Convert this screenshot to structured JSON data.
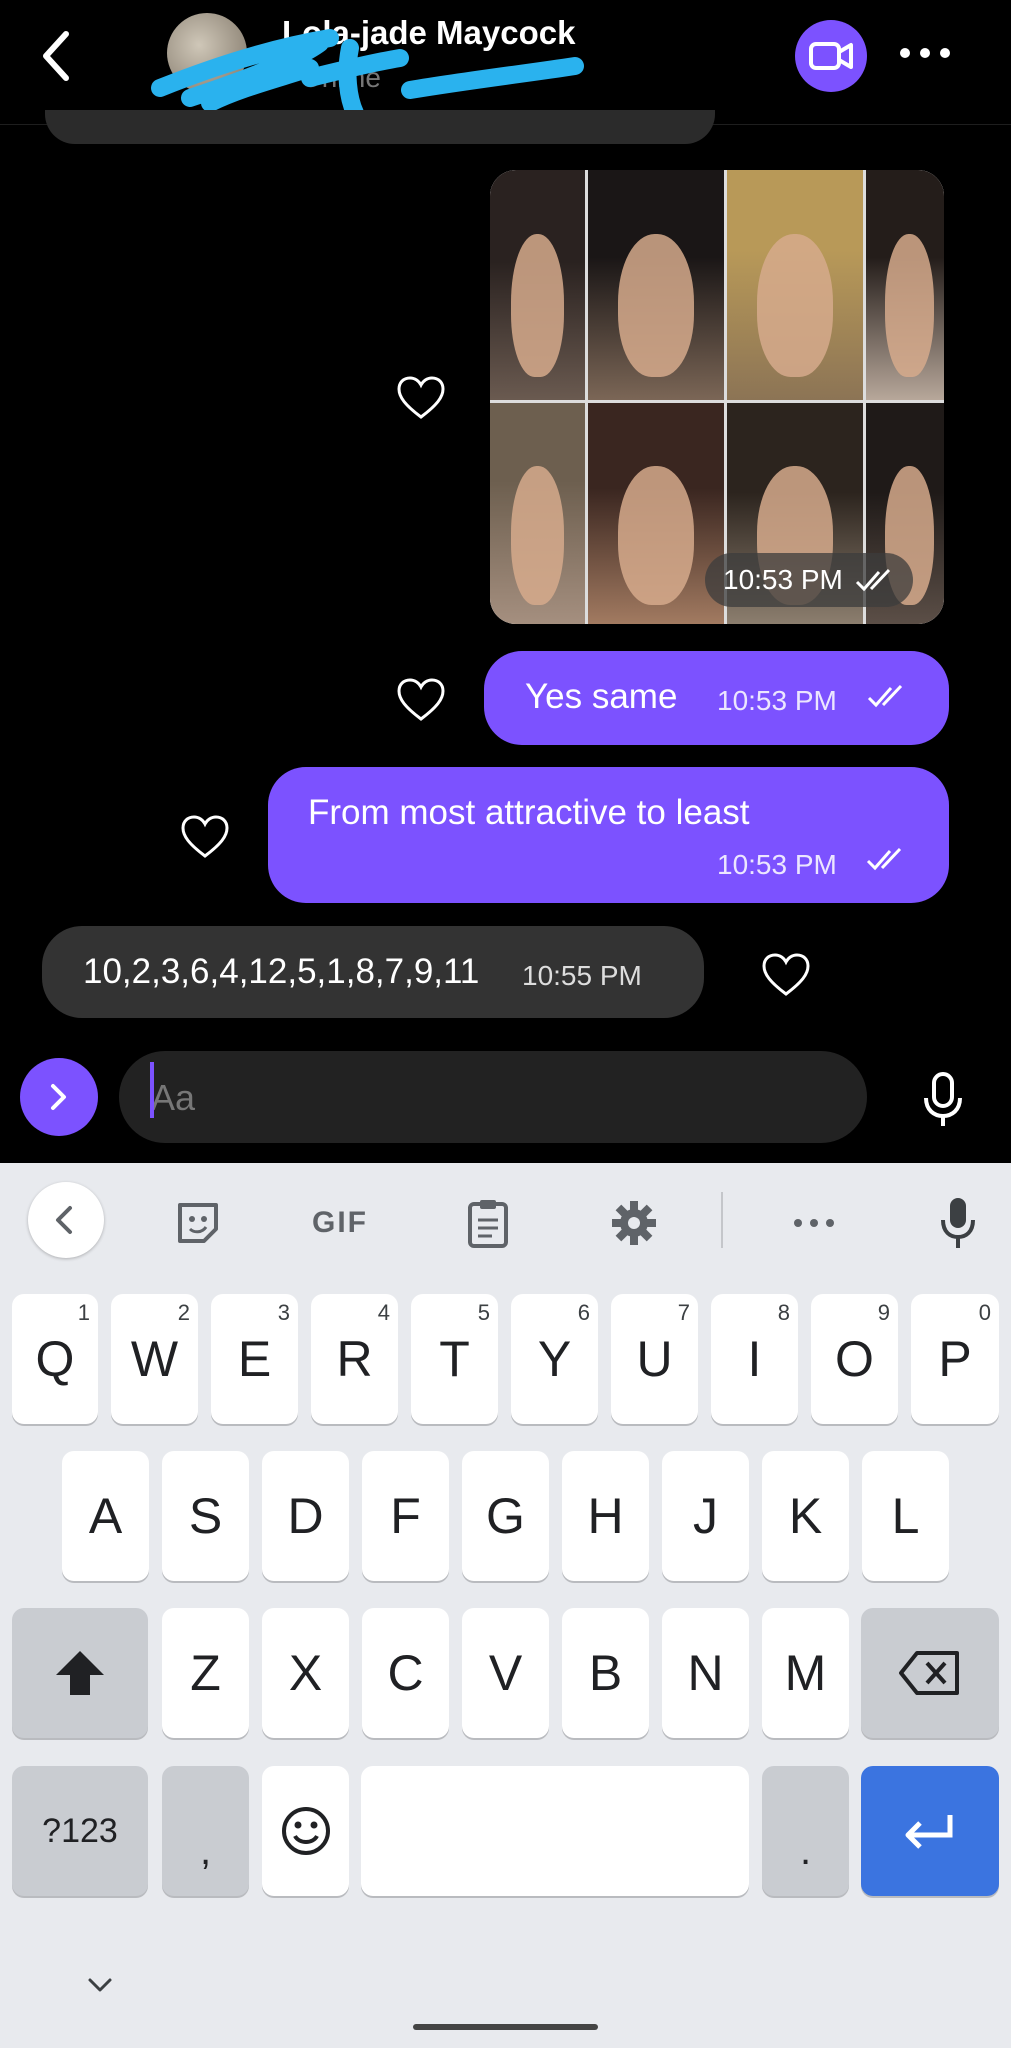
{
  "header": {
    "contact_name": "Lola-jade Maycock",
    "status": "Online",
    "video_call_icon": "video-icon",
    "more_icon": "more-horizontal-icon",
    "back_icon": "chevron-left-icon"
  },
  "messages": [
    {
      "type": "image",
      "direction": "outgoing",
      "time": "10:53 PM",
      "read": true,
      "liked": false
    },
    {
      "type": "text",
      "direction": "outgoing",
      "text": "Yes same",
      "time": "10:53 PM",
      "read": true,
      "liked": false
    },
    {
      "type": "text",
      "direction": "outgoing",
      "text": "From most attractive to least",
      "time": "10:53 PM",
      "read": true,
      "liked": false
    },
    {
      "type": "text",
      "direction": "incoming",
      "text": "10,2,3,6,4,12,5,1,8,7,9,11",
      "time": "10:55 PM",
      "liked": false
    }
  ],
  "composer": {
    "placeholder": "Aa",
    "value": ""
  },
  "keyboard": {
    "toolbar": [
      "chevron-left-icon",
      "sticker-icon",
      "GIF",
      "clipboard-icon",
      "gear-icon",
      "more-horizontal-icon",
      "mic-icon"
    ],
    "row1": [
      {
        "key": "Q",
        "hint": "1"
      },
      {
        "key": "W",
        "hint": "2"
      },
      {
        "key": "E",
        "hint": "3"
      },
      {
        "key": "R",
        "hint": "4"
      },
      {
        "key": "T",
        "hint": "5"
      },
      {
        "key": "Y",
        "hint": "6"
      },
      {
        "key": "U",
        "hint": "7"
      },
      {
        "key": "I",
        "hint": "8"
      },
      {
        "key": "O",
        "hint": "9"
      },
      {
        "key": "P",
        "hint": "0"
      }
    ],
    "row2": [
      "A",
      "S",
      "D",
      "F",
      "G",
      "H",
      "J",
      "K",
      "L"
    ],
    "row3": [
      "Z",
      "X",
      "C",
      "V",
      "B",
      "N",
      "M"
    ],
    "symbols": "?123",
    "comma": ",",
    "period": "."
  },
  "colors": {
    "accent": "#7c52ff",
    "background": "#000000",
    "incoming_bubble": "#333333",
    "keyboard_bg": "#e8eaee",
    "enter_key": "#3b74e0"
  }
}
